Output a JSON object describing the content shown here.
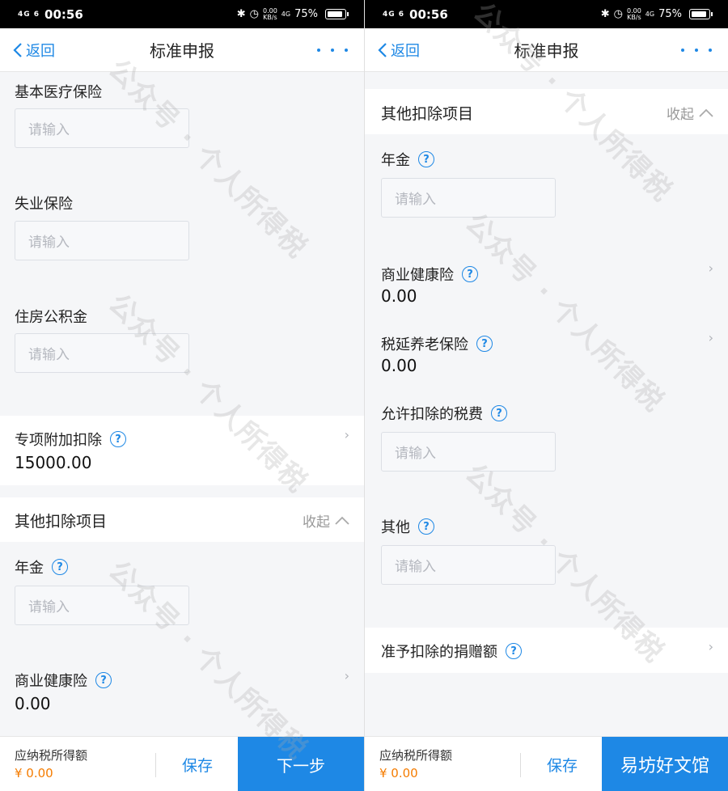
{
  "status": {
    "signal_left": "4G 6",
    "time": "00:56",
    "speed": "0.00",
    "speed_unit": "KB/s",
    "net": "4G",
    "battery": "75%",
    "battery_level": 0.75
  },
  "nav": {
    "back": "返回",
    "title": "标准申报"
  },
  "left": {
    "fields": [
      {
        "label": "基本医疗保险",
        "placeholder": "请输入"
      },
      {
        "label": "失业保险",
        "placeholder": "请输入"
      },
      {
        "label": "住房公积金",
        "placeholder": "请输入"
      }
    ],
    "special": {
      "label": "专项附加扣除",
      "value": "15000.00"
    },
    "other": {
      "title": "其他扣除项目",
      "collapse": "收起"
    },
    "annuity": {
      "label": "年金",
      "placeholder": "请输入"
    },
    "health": {
      "label": "商业健康险",
      "value": "0.00"
    }
  },
  "right": {
    "other": {
      "title": "其他扣除项目",
      "collapse": "收起"
    },
    "annuity": {
      "label": "年金",
      "placeholder": "请输入"
    },
    "health": {
      "label": "商业健康险",
      "value": "0.00"
    },
    "pension": {
      "label": "税延养老保险",
      "value": "0.00"
    },
    "tax_fee": {
      "label": "允许扣除的税费",
      "placeholder": "请输入"
    },
    "others": {
      "label": "其他",
      "placeholder": "请输入"
    },
    "donation": {
      "label": "准予扣除的捐赠额"
    }
  },
  "bottom": {
    "label": "应纳税所得额",
    "amount": "¥ 0.00",
    "save": "保存",
    "next": "下一步"
  },
  "overlay": {
    "brand": "易坊好文馆"
  },
  "watermark": "公众号 · 个人所得税"
}
